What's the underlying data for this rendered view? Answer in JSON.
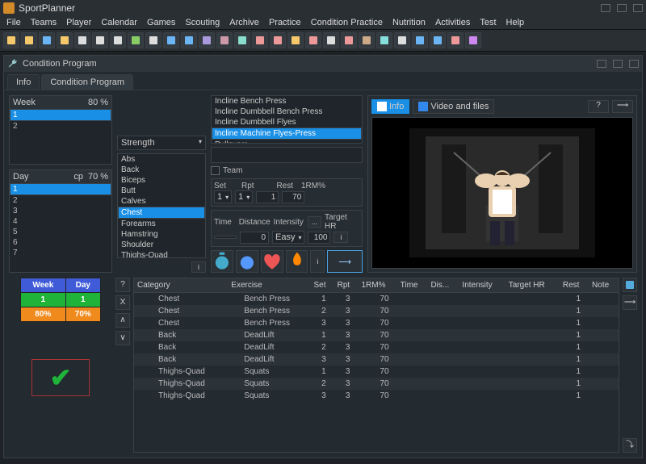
{
  "app": {
    "title": "SportPlanner"
  },
  "menu": [
    "File",
    "Teams",
    "Player",
    "Calendar",
    "Games",
    "Scouting",
    "Archive",
    "Practice",
    "Condition Practice",
    "Nutrition",
    "Activities",
    "Test",
    "Help"
  ],
  "innerWindow": {
    "title": "Condition Program"
  },
  "tabs": [
    {
      "label": "Info",
      "active": false
    },
    {
      "label": "Condition Program",
      "active": true
    }
  ],
  "week": {
    "header": "Week",
    "pct": "80",
    "pctSuffix": "%",
    "rows": [
      {
        "n": "1",
        "sel": true
      },
      {
        "n": "2"
      }
    ]
  },
  "day": {
    "header": "Day",
    "cp": "cp",
    "pct": "70",
    "pctSuffix": "%",
    "rows": [
      {
        "n": "1",
        "sel": true
      },
      {
        "n": "2"
      },
      {
        "n": "3"
      },
      {
        "n": "4"
      },
      {
        "n": "5"
      },
      {
        "n": "6"
      },
      {
        "n": "7"
      }
    ]
  },
  "strengthSelect": "Strength",
  "muscleGroups": [
    "Abs",
    "Back",
    "Biceps",
    "Butt",
    "Calves",
    "Chest",
    "Forearms",
    "Hamstring",
    "Shoulder",
    "Thighs-Quad"
  ],
  "muscleSelected": "Chest",
  "exercises": [
    "Incline Bench Press",
    "Incline Dumbbell Bench Press",
    "Incline Dumbbell Flyes",
    "Incline Machine Flyes-Press",
    "Pullovers"
  ],
  "exerciseSelected": "Incline Machine Flyes-Press",
  "teamLabel": "Team",
  "setRow": {
    "set": "Set",
    "rpt": "Rpt",
    "rest": "Rest",
    "rm": "1RM%",
    "setVal": "1",
    "rptVal": "1",
    "restVal": "1",
    "rmVal": "70"
  },
  "metricsRow": {
    "time": "Time",
    "distance": "Distance",
    "intensity": "Intensity",
    "target": "Target HR",
    "timeVal": "",
    "distVal": "0",
    "intVal": "Easy",
    "targetVal": "100"
  },
  "previewTabs": [
    {
      "label": "Info",
      "active": true
    },
    {
      "label": "Video and files"
    }
  ],
  "summary": {
    "week": "Week",
    "day": "Day",
    "wVal": "1",
    "dVal": "1",
    "wPct": "80%",
    "dPct": "70%"
  },
  "tableHeaders": [
    "Category",
    "Exercise",
    "Set",
    "Rpt",
    "1RM%",
    "Time",
    "Dis...",
    "Intensity",
    "Target HR",
    "Rest",
    "Note"
  ],
  "tableRows": [
    {
      "cat": "Chest",
      "ex": "Bench Press",
      "set": "1",
      "rpt": "3",
      "rm": "70",
      "rest": "1"
    },
    {
      "cat": "Chest",
      "ex": "Bench Press",
      "set": "2",
      "rpt": "3",
      "rm": "70",
      "rest": "1"
    },
    {
      "cat": "Chest",
      "ex": "Bench Press",
      "set": "3",
      "rpt": "3",
      "rm": "70",
      "rest": "1"
    },
    {
      "cat": "Back",
      "ex": "DeadLift",
      "set": "1",
      "rpt": "3",
      "rm": "70",
      "rest": "1"
    },
    {
      "cat": "Back",
      "ex": "DeadLift",
      "set": "2",
      "rpt": "3",
      "rm": "70",
      "rest": "1"
    },
    {
      "cat": "Back",
      "ex": "DeadLift",
      "set": "3",
      "rpt": "3",
      "rm": "70",
      "rest": "1"
    },
    {
      "cat": "Thighs-Quad",
      "ex": "Squats",
      "set": "1",
      "rpt": "3",
      "rm": "70",
      "rest": "1"
    },
    {
      "cat": "Thighs-Quad",
      "ex": "Squats",
      "set": "2",
      "rpt": "3",
      "rm": "70",
      "rest": "1"
    },
    {
      "cat": "Thighs-Quad",
      "ex": "Squats",
      "set": "3",
      "rpt": "3",
      "rm": "70",
      "rest": "1"
    }
  ],
  "sideBtns": [
    "?",
    "X",
    "∧",
    "∨"
  ],
  "helpBtn": "?",
  "arrowBtn": "⟶",
  "cornerArrow": "⤵",
  "ellipsis": "...",
  "iBtn": "i"
}
